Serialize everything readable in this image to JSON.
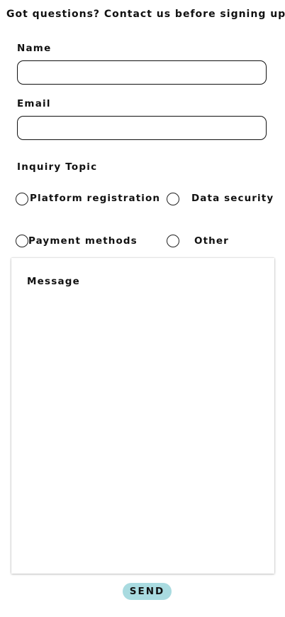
{
  "form": {
    "heading": "Got questions? Contact us before signing up",
    "name_label": "Name",
    "name_value": "",
    "email_label": "Email",
    "email_value": "",
    "topic_label": "Inquiry Topic",
    "topics": [
      {
        "label": "Platform registration",
        "selected": false
      },
      {
        "label": "Data security",
        "selected": false
      },
      {
        "label": "Payment methods",
        "selected": false
      },
      {
        "label": "Other",
        "selected": false
      }
    ],
    "message_label": "Message",
    "send_label": "SEND"
  },
  "colors": {
    "send_button_bg": "#a9dbe0",
    "border": "#111111"
  }
}
